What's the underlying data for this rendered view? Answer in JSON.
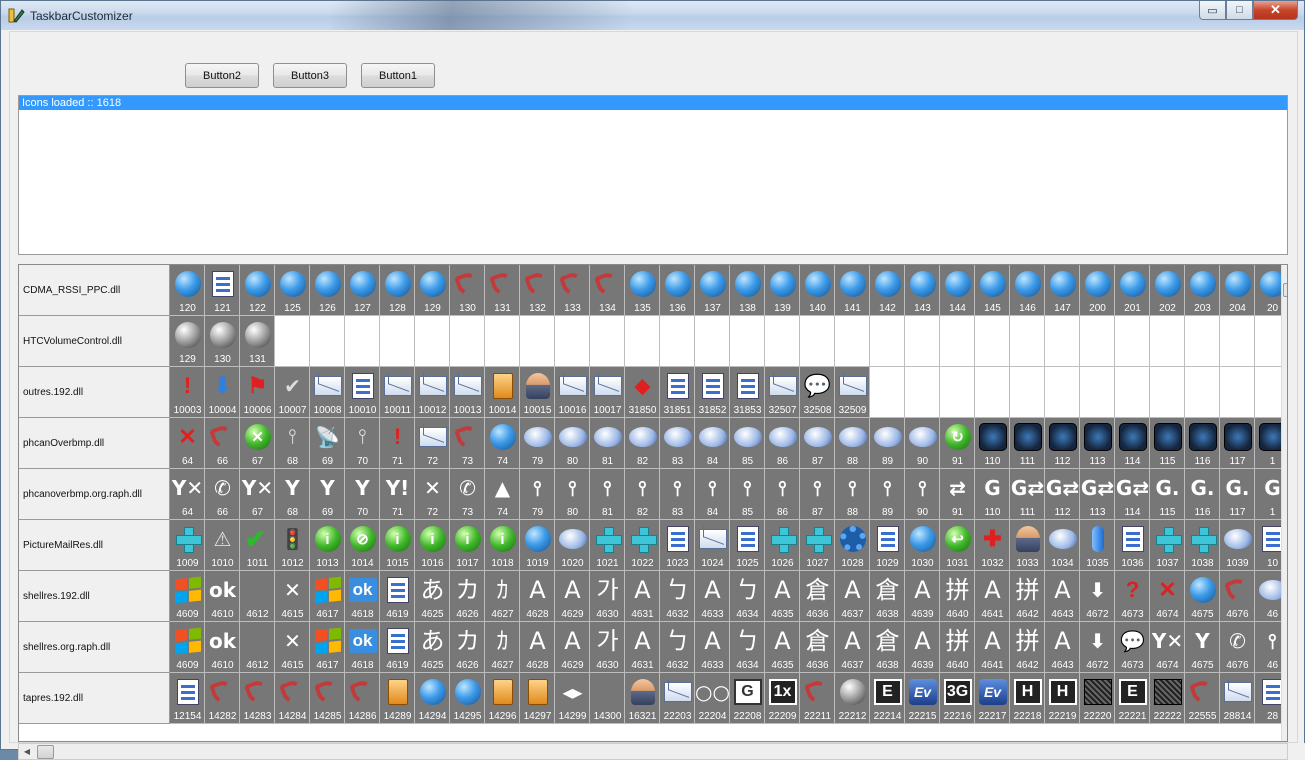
{
  "window": {
    "title": "TaskbarCustomizer",
    "controls": {
      "minimize": "▭",
      "maximize": "□",
      "close": "✕"
    }
  },
  "toolbar": {
    "buttons": [
      {
        "label": "Button2"
      },
      {
        "label": "Button3"
      },
      {
        "label": "Button1"
      }
    ]
  },
  "log": {
    "lines": [
      "Icons loaded :: 1618"
    ]
  },
  "rows": [
    {
      "name": "CDMA_RSSI_PPC.dll",
      "icons": [
        {
          "n": "120",
          "t": "globe"
        },
        {
          "n": "121",
          "t": "doc"
        },
        {
          "n": "122",
          "t": "globe"
        },
        {
          "n": "125",
          "t": "globe"
        },
        {
          "n": "126",
          "t": "globe"
        },
        {
          "n": "127",
          "t": "globe"
        },
        {
          "n": "128",
          "t": "globe"
        },
        {
          "n": "129",
          "t": "globe"
        },
        {
          "n": "130",
          "t": "phone"
        },
        {
          "n": "131",
          "t": "phone"
        },
        {
          "n": "132",
          "t": "phone"
        },
        {
          "n": "133",
          "t": "phone"
        },
        {
          "n": "134",
          "t": "phone"
        },
        {
          "n": "135",
          "t": "globe"
        },
        {
          "n": "136",
          "t": "globe"
        },
        {
          "n": "137",
          "t": "globe"
        },
        {
          "n": "138",
          "t": "globe"
        },
        {
          "n": "139",
          "t": "globe"
        },
        {
          "n": "140",
          "t": "globe"
        },
        {
          "n": "141",
          "t": "globe"
        },
        {
          "n": "142",
          "t": "globe"
        },
        {
          "n": "143",
          "t": "globe"
        },
        {
          "n": "144",
          "t": "globe"
        },
        {
          "n": "145",
          "t": "globe"
        },
        {
          "n": "146",
          "t": "globe"
        },
        {
          "n": "147",
          "t": "globe"
        },
        {
          "n": "200",
          "t": "globe"
        },
        {
          "n": "201",
          "t": "globe"
        },
        {
          "n": "202",
          "t": "globe"
        },
        {
          "n": "203",
          "t": "globe"
        },
        {
          "n": "204",
          "t": "globe"
        },
        {
          "n": "20",
          "t": "globe"
        }
      ]
    },
    {
      "name": "HTCVolumeControl.dll",
      "icons": [
        {
          "n": "129",
          "t": "speaker"
        },
        {
          "n": "130",
          "t": "speaker"
        },
        {
          "n": "131",
          "t": "speaker"
        }
      ]
    },
    {
      "name": "outres.192.dll",
      "icons": [
        {
          "n": "10003",
          "t": "red",
          "g": "!"
        },
        {
          "n": "10004",
          "t": "blue",
          "g": "⬇"
        },
        {
          "n": "10006",
          "t": "red",
          "g": "⚑"
        },
        {
          "n": "10007",
          "t": "dark",
          "g": "✔"
        },
        {
          "n": "10008",
          "t": "mail"
        },
        {
          "n": "10010",
          "t": "doc"
        },
        {
          "n": "10011",
          "t": "mail"
        },
        {
          "n": "10012",
          "t": "mail"
        },
        {
          "n": "10013",
          "t": "mail"
        },
        {
          "n": "10014",
          "t": "orange"
        },
        {
          "n": "10015",
          "t": "person"
        },
        {
          "n": "10016",
          "t": "mail"
        },
        {
          "n": "10017",
          "t": "mail"
        },
        {
          "n": "31850",
          "t": "red",
          "g": "⬥"
        },
        {
          "n": "31851",
          "t": "doc"
        },
        {
          "n": "31852",
          "t": "doc"
        },
        {
          "n": "31853",
          "t": "doc"
        },
        {
          "n": "32507",
          "t": "mail"
        },
        {
          "n": "32508",
          "t": "blue",
          "g": "💬"
        },
        {
          "n": "32509",
          "t": "mail"
        }
      ]
    },
    {
      "name": "phcanOverbmp.dll",
      "icons": [
        {
          "n": "64",
          "t": "red",
          "g": "✕"
        },
        {
          "n": "66",
          "t": "phone"
        },
        {
          "n": "67",
          "t": "green",
          "g": "✕"
        },
        {
          "n": "68",
          "t": "dark",
          "g": "⫯"
        },
        {
          "n": "69",
          "t": "dark",
          "g": "📡"
        },
        {
          "n": "70",
          "t": "dark",
          "g": "⫯"
        },
        {
          "n": "71",
          "t": "red",
          "g": "!"
        },
        {
          "n": "72",
          "t": "mail"
        },
        {
          "n": "73",
          "t": "phone"
        },
        {
          "n": "74",
          "t": "globe"
        },
        {
          "n": "79",
          "t": "wifi"
        },
        {
          "n": "80",
          "t": "wifi"
        },
        {
          "n": "81",
          "t": "wifi"
        },
        {
          "n": "82",
          "t": "wifi"
        },
        {
          "n": "83",
          "t": "wifi"
        },
        {
          "n": "84",
          "t": "wifi"
        },
        {
          "n": "85",
          "t": "wifi"
        },
        {
          "n": "86",
          "t": "wifi"
        },
        {
          "n": "87",
          "t": "wifi"
        },
        {
          "n": "88",
          "t": "wifi"
        },
        {
          "n": "89",
          "t": "wifi"
        },
        {
          "n": "90",
          "t": "wifi"
        },
        {
          "n": "91",
          "t": "green",
          "g": "↻"
        },
        {
          "n": "110",
          "t": "gbox"
        },
        {
          "n": "111",
          "t": "gbox"
        },
        {
          "n": "112",
          "t": "gbox"
        },
        {
          "n": "113",
          "t": "gbox"
        },
        {
          "n": "114",
          "t": "gbox"
        },
        {
          "n": "115",
          "t": "gbox"
        },
        {
          "n": "116",
          "t": "gbox"
        },
        {
          "n": "117",
          "t": "gbox"
        },
        {
          "n": "1",
          "t": "gbox"
        }
      ]
    },
    {
      "name": "phcanoverbmp.org.raph.dll",
      "icons": [
        {
          "n": "64",
          "t": "white",
          "g": "Y✕"
        },
        {
          "n": "66",
          "t": "white",
          "g": "✆"
        },
        {
          "n": "67",
          "t": "white",
          "g": "Y✕"
        },
        {
          "n": "68",
          "t": "white",
          "g": "Y"
        },
        {
          "n": "69",
          "t": "white",
          "g": "Y"
        },
        {
          "n": "70",
          "t": "white",
          "g": "Y"
        },
        {
          "n": "71",
          "t": "white",
          "g": "Y!"
        },
        {
          "n": "72",
          "t": "white",
          "g": "✕"
        },
        {
          "n": "73",
          "t": "white",
          "g": "✆"
        },
        {
          "n": "74",
          "t": "white",
          "g": "▲"
        },
        {
          "n": "79",
          "t": "white",
          "g": "⫯"
        },
        {
          "n": "80",
          "t": "white",
          "g": "⫯"
        },
        {
          "n": "81",
          "t": "white",
          "g": "⫯"
        },
        {
          "n": "82",
          "t": "white",
          "g": "⫯"
        },
        {
          "n": "83",
          "t": "white",
          "g": "⫯"
        },
        {
          "n": "84",
          "t": "white",
          "g": "⫯"
        },
        {
          "n": "85",
          "t": "white",
          "g": "⫯"
        },
        {
          "n": "86",
          "t": "white",
          "g": "⫯"
        },
        {
          "n": "87",
          "t": "white",
          "g": "⫯"
        },
        {
          "n": "88",
          "t": "white",
          "g": "⫯"
        },
        {
          "n": "89",
          "t": "white",
          "g": "⫯"
        },
        {
          "n": "90",
          "t": "white",
          "g": "⫯"
        },
        {
          "n": "91",
          "t": "white",
          "g": "⇄"
        },
        {
          "n": "110",
          "t": "white",
          "g": "G"
        },
        {
          "n": "111",
          "t": "white",
          "g": "G⇄"
        },
        {
          "n": "112",
          "t": "white",
          "g": "G⇄"
        },
        {
          "n": "113",
          "t": "white",
          "g": "G⇄"
        },
        {
          "n": "114",
          "t": "white",
          "g": "G⇄"
        },
        {
          "n": "115",
          "t": "white",
          "g": "G."
        },
        {
          "n": "116",
          "t": "white",
          "g": "G."
        },
        {
          "n": "117",
          "t": "white",
          "g": "G."
        },
        {
          "n": "1",
          "t": "white",
          "g": "G"
        }
      ]
    },
    {
      "name": "PictureMailRes.dll",
      "icons": [
        {
          "n": "1009",
          "t": "cross"
        },
        {
          "n": "1010",
          "t": "dark",
          "g": "⚠"
        },
        {
          "n": "1011",
          "t": "check",
          "g": "✔"
        },
        {
          "n": "1012",
          "t": "dark",
          "g": "🚦"
        },
        {
          "n": "1013",
          "t": "green",
          "g": "i"
        },
        {
          "n": "1014",
          "t": "green",
          "g": "⊘"
        },
        {
          "n": "1015",
          "t": "green",
          "g": "i"
        },
        {
          "n": "1016",
          "t": "green",
          "g": "i"
        },
        {
          "n": "1017",
          "t": "green",
          "g": "i"
        },
        {
          "n": "1018",
          "t": "green",
          "g": "i"
        },
        {
          "n": "1019",
          "t": "globe"
        },
        {
          "n": "1020",
          "t": "wifi"
        },
        {
          "n": "1021",
          "t": "cross"
        },
        {
          "n": "1022",
          "t": "cross"
        },
        {
          "n": "1023",
          "t": "doc"
        },
        {
          "n": "1024",
          "t": "mail"
        },
        {
          "n": "1025",
          "t": "doc"
        },
        {
          "n": "1026",
          "t": "cross"
        },
        {
          "n": "1027",
          "t": "cross"
        },
        {
          "n": "1028",
          "t": "gear"
        },
        {
          "n": "1029",
          "t": "doc"
        },
        {
          "n": "1030",
          "t": "globe"
        },
        {
          "n": "1031",
          "t": "green",
          "g": "↩"
        },
        {
          "n": "1032",
          "t": "red",
          "g": "✚"
        },
        {
          "n": "1033",
          "t": "person"
        },
        {
          "n": "1034",
          "t": "wifi"
        },
        {
          "n": "1035",
          "t": "mic"
        },
        {
          "n": "1036",
          "t": "doc"
        },
        {
          "n": "1037",
          "t": "cross"
        },
        {
          "n": "1038",
          "t": "cross"
        },
        {
          "n": "1039",
          "t": "wifi"
        },
        {
          "n": "10",
          "t": "doc"
        }
      ]
    },
    {
      "name": "shellres.192.dll",
      "icons": [
        {
          "n": "4609",
          "t": "winflag"
        },
        {
          "n": "4610",
          "t": "white",
          "g": "ok"
        },
        {
          "n": "4612",
          "t": "none"
        },
        {
          "n": "4615",
          "t": "white",
          "g": "✕"
        },
        {
          "n": "4617",
          "t": "winflag"
        },
        {
          "n": "4618",
          "t": "okbox",
          "g": "ok"
        },
        {
          "n": "4619",
          "t": "doc"
        },
        {
          "n": "4625",
          "t": "txt",
          "g": "あ"
        },
        {
          "n": "4626",
          "t": "txt",
          "g": "カ"
        },
        {
          "n": "4627",
          "t": "txt",
          "g": "ｶ"
        },
        {
          "n": "4628",
          "t": "txt",
          "g": "A"
        },
        {
          "n": "4629",
          "t": "txt",
          "g": "A"
        },
        {
          "n": "4630",
          "t": "txt",
          "g": "가"
        },
        {
          "n": "4631",
          "t": "txt",
          "g": "A"
        },
        {
          "n": "4632",
          "t": "txt",
          "g": "ㄅ"
        },
        {
          "n": "4633",
          "t": "txt",
          "g": "A"
        },
        {
          "n": "4634",
          "t": "txt",
          "g": "ㄅ"
        },
        {
          "n": "4635",
          "t": "txt",
          "g": "A"
        },
        {
          "n": "4636",
          "t": "txt",
          "g": "倉"
        },
        {
          "n": "4637",
          "t": "txt",
          "g": "A"
        },
        {
          "n": "4638",
          "t": "txt",
          "g": "倉"
        },
        {
          "n": "4639",
          "t": "txt",
          "g": "A"
        },
        {
          "n": "4640",
          "t": "txt",
          "g": "拼"
        },
        {
          "n": "4641",
          "t": "txt",
          "g": "A"
        },
        {
          "n": "4642",
          "t": "txt",
          "g": "拼"
        },
        {
          "n": "4643",
          "t": "txt",
          "g": "A"
        },
        {
          "n": "4672",
          "t": "white",
          "g": "⬇"
        },
        {
          "n": "4673",
          "t": "red",
          "g": "?"
        },
        {
          "n": "4674",
          "t": "red",
          "g": "✕"
        },
        {
          "n": "4675",
          "t": "globe"
        },
        {
          "n": "4676",
          "t": "phone"
        },
        {
          "n": "46",
          "t": "wifi"
        }
      ]
    },
    {
      "name": "shellres.org.raph.dll",
      "icons": [
        {
          "n": "4609",
          "t": "winflag"
        },
        {
          "n": "4610",
          "t": "white",
          "g": "ok"
        },
        {
          "n": "4612",
          "t": "none"
        },
        {
          "n": "4615",
          "t": "white",
          "g": "✕"
        },
        {
          "n": "4617",
          "t": "winflag"
        },
        {
          "n": "4618",
          "t": "okbox",
          "g": "ok"
        },
        {
          "n": "4619",
          "t": "doc"
        },
        {
          "n": "4625",
          "t": "txt",
          "g": "あ"
        },
        {
          "n": "4626",
          "t": "txt",
          "g": "カ"
        },
        {
          "n": "4627",
          "t": "txt",
          "g": "ｶ"
        },
        {
          "n": "4628",
          "t": "txt",
          "g": "A"
        },
        {
          "n": "4629",
          "t": "txt",
          "g": "A"
        },
        {
          "n": "4630",
          "t": "txt",
          "g": "가"
        },
        {
          "n": "4631",
          "t": "txt",
          "g": "A"
        },
        {
          "n": "4632",
          "t": "txt",
          "g": "ㄅ"
        },
        {
          "n": "4633",
          "t": "txt",
          "g": "A"
        },
        {
          "n": "4634",
          "t": "txt",
          "g": "ㄅ"
        },
        {
          "n": "4635",
          "t": "txt",
          "g": "A"
        },
        {
          "n": "4636",
          "t": "txt",
          "g": "倉"
        },
        {
          "n": "4637",
          "t": "txt",
          "g": "A"
        },
        {
          "n": "4638",
          "t": "txt",
          "g": "倉"
        },
        {
          "n": "4639",
          "t": "txt",
          "g": "A"
        },
        {
          "n": "4640",
          "t": "txt",
          "g": "拼"
        },
        {
          "n": "4641",
          "t": "txt",
          "g": "A"
        },
        {
          "n": "4642",
          "t": "txt",
          "g": "拼"
        },
        {
          "n": "4643",
          "t": "txt",
          "g": "A"
        },
        {
          "n": "4672",
          "t": "white",
          "g": "⬇"
        },
        {
          "n": "4673",
          "t": "white",
          "g": "💬"
        },
        {
          "n": "4674",
          "t": "white",
          "g": "Y✕"
        },
        {
          "n": "4675",
          "t": "white",
          "g": "Y"
        },
        {
          "n": "4676",
          "t": "white",
          "g": "✆"
        },
        {
          "n": "46",
          "t": "white",
          "g": "⫯"
        }
      ]
    },
    {
      "name": "tapres.192.dll",
      "icons": [
        {
          "n": "12154",
          "t": "doc"
        },
        {
          "n": "14282",
          "t": "phone"
        },
        {
          "n": "14283",
          "t": "phone"
        },
        {
          "n": "14284",
          "t": "phone"
        },
        {
          "n": "14285",
          "t": "phone"
        },
        {
          "n": "14286",
          "t": "phone"
        },
        {
          "n": "14289",
          "t": "orange"
        },
        {
          "n": "14294",
          "t": "globe"
        },
        {
          "n": "14295",
          "t": "globe"
        },
        {
          "n": "14296",
          "t": "orange"
        },
        {
          "n": "14297",
          "t": "orange"
        },
        {
          "n": "14299",
          "t": "white",
          "g": "◂▸"
        },
        {
          "n": "14300",
          "t": "none"
        },
        {
          "n": "16321",
          "t": "person"
        },
        {
          "n": "22203",
          "t": "mail"
        },
        {
          "n": "22204",
          "t": "white",
          "g": "○○"
        },
        {
          "n": "22208",
          "t": "boxlight",
          "g": "G"
        },
        {
          "n": "22209",
          "t": "box",
          "g": "1x"
        },
        {
          "n": "22211",
          "t": "phone"
        },
        {
          "n": "22212",
          "t": "speaker"
        },
        {
          "n": "22214",
          "t": "box",
          "g": "E"
        },
        {
          "n": "22215",
          "t": "ev",
          "g": "Ev"
        },
        {
          "n": "22216",
          "t": "box",
          "g": "3G"
        },
        {
          "n": "22217",
          "t": "ev",
          "g": "Ev"
        },
        {
          "n": "22218",
          "t": "box",
          "g": "H"
        },
        {
          "n": "22219",
          "t": "box",
          "g": "H"
        },
        {
          "n": "22220",
          "t": "noise"
        },
        {
          "n": "22221",
          "t": "box",
          "g": "E"
        },
        {
          "n": "22222",
          "t": "noise"
        },
        {
          "n": "22555",
          "t": "phone"
        },
        {
          "n": "28814",
          "t": "mail"
        },
        {
          "n": "28",
          "t": "doc"
        }
      ]
    }
  ]
}
